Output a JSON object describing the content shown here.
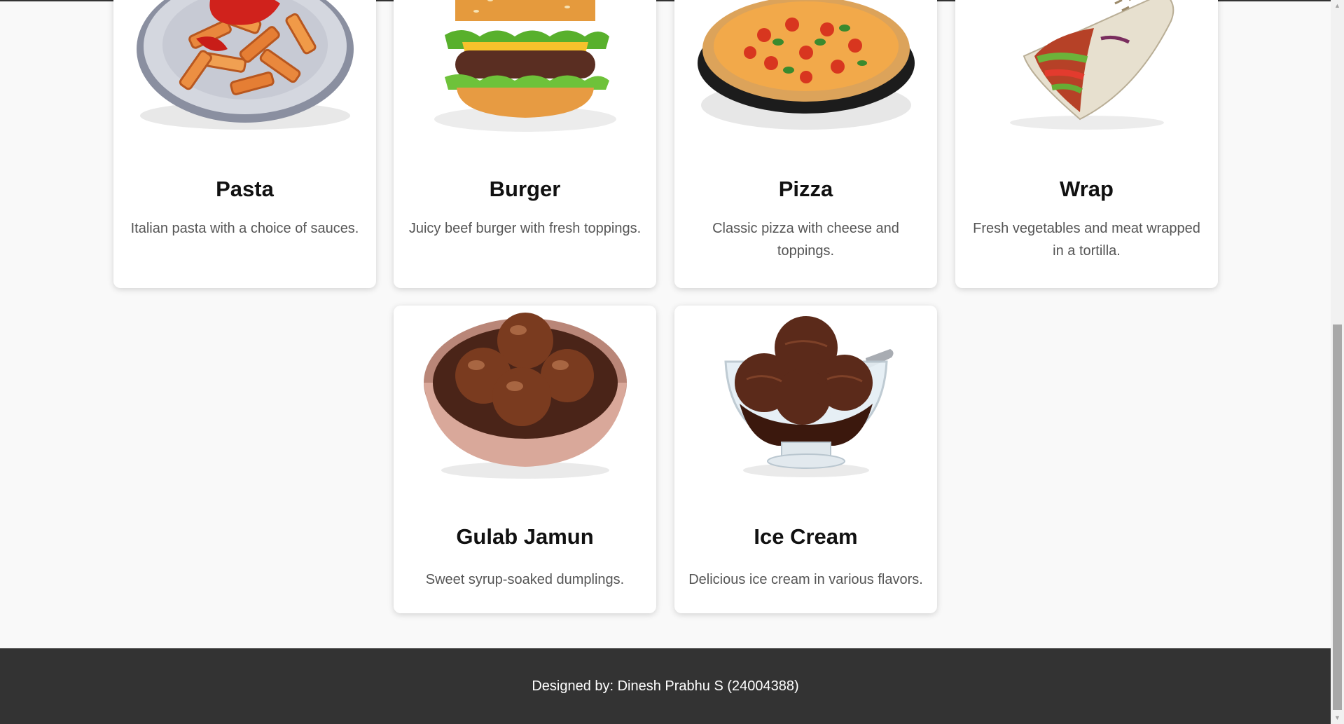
{
  "menu": {
    "items": [
      {
        "name": "Pasta",
        "description": "Italian pasta with a choice of sauces.",
        "icon": "pasta-dish"
      },
      {
        "name": "Burger",
        "description": "Juicy beef burger with fresh toppings.",
        "icon": "burger"
      },
      {
        "name": "Pizza",
        "description": "Classic pizza with cheese and toppings.",
        "icon": "pizza"
      },
      {
        "name": "Wrap",
        "description": "Fresh vegetables and meat wrapped in a tortilla.",
        "icon": "wrap"
      },
      {
        "name": "Gulab Jamun",
        "description": "Sweet syrup-soaked dumplings.",
        "icon": "gulab-jamun-bowl"
      },
      {
        "name": "Ice Cream",
        "description": "Delicious ice cream in various flavors.",
        "icon": "ice-cream-bowl"
      }
    ]
  },
  "footer": {
    "text": "Designed by: Dinesh Prabhu S (24004388)"
  },
  "colors": {
    "footer_bg": "#333333",
    "page_bg": "#f9f9f9",
    "card_bg": "#ffffff"
  }
}
